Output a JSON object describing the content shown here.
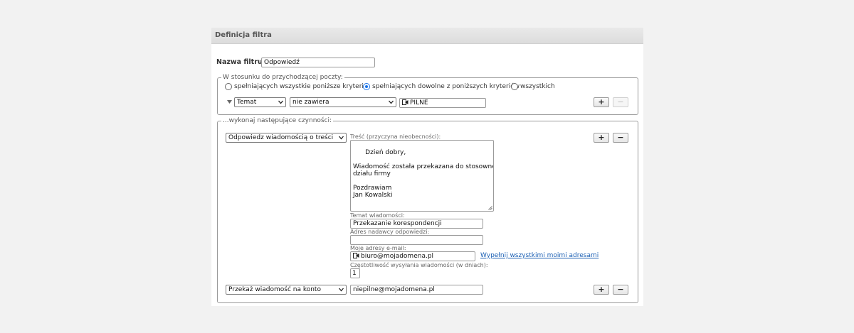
{
  "header": {
    "title": "Definicja filtra"
  },
  "filter_name": {
    "label": "Nazwa filtru:",
    "value": "Odpowiedź"
  },
  "incoming": {
    "legend": "W stosunku do przychodzącej poczty:",
    "options": [
      {
        "label": "spełniających wszystkie poniższe kryteria",
        "selected": false
      },
      {
        "label": "spełniających dowolne z poniższych kryteriów",
        "selected": true
      },
      {
        "label": "wszystkich",
        "selected": false
      }
    ],
    "rule": {
      "field": "Temat",
      "operator": "nie zawiera",
      "value": "PILNE"
    },
    "add_label": "+",
    "remove_label": "−"
  },
  "actions": {
    "legend": "...wykonaj następujące czynności:",
    "action1": {
      "type": "Odpowiedz wiadomością o treści",
      "body_label": "Treść (przyczyna nieobecności):",
      "body": "Dzień dobry,\n\nWiadomość została przekazana do stosownego\ndziału firmy\n\nPozdrawiam\nJan Kowalski",
      "subject_label": "Temat wiadomości:",
      "subject": "Przekazanie korespondencji",
      "reply_to_label": "Adres nadawcy odpowiedzi:",
      "reply_to": "",
      "my_addresses_label": "Moje adresy e-mail:",
      "my_address": "biuro@mojadomena.pl",
      "fill_all_link": "Wypełnij wszystkimi moimi adresami",
      "frequency_label": "Częstotliwość wysyłania wiadomości (w dniach):",
      "frequency": "1",
      "add_label": "+",
      "remove_label": "−"
    },
    "action2": {
      "type": "Przekaż wiadomość na konto",
      "target": "niepilne@mojadomena.pl",
      "add_label": "+",
      "remove_label": "−"
    }
  }
}
